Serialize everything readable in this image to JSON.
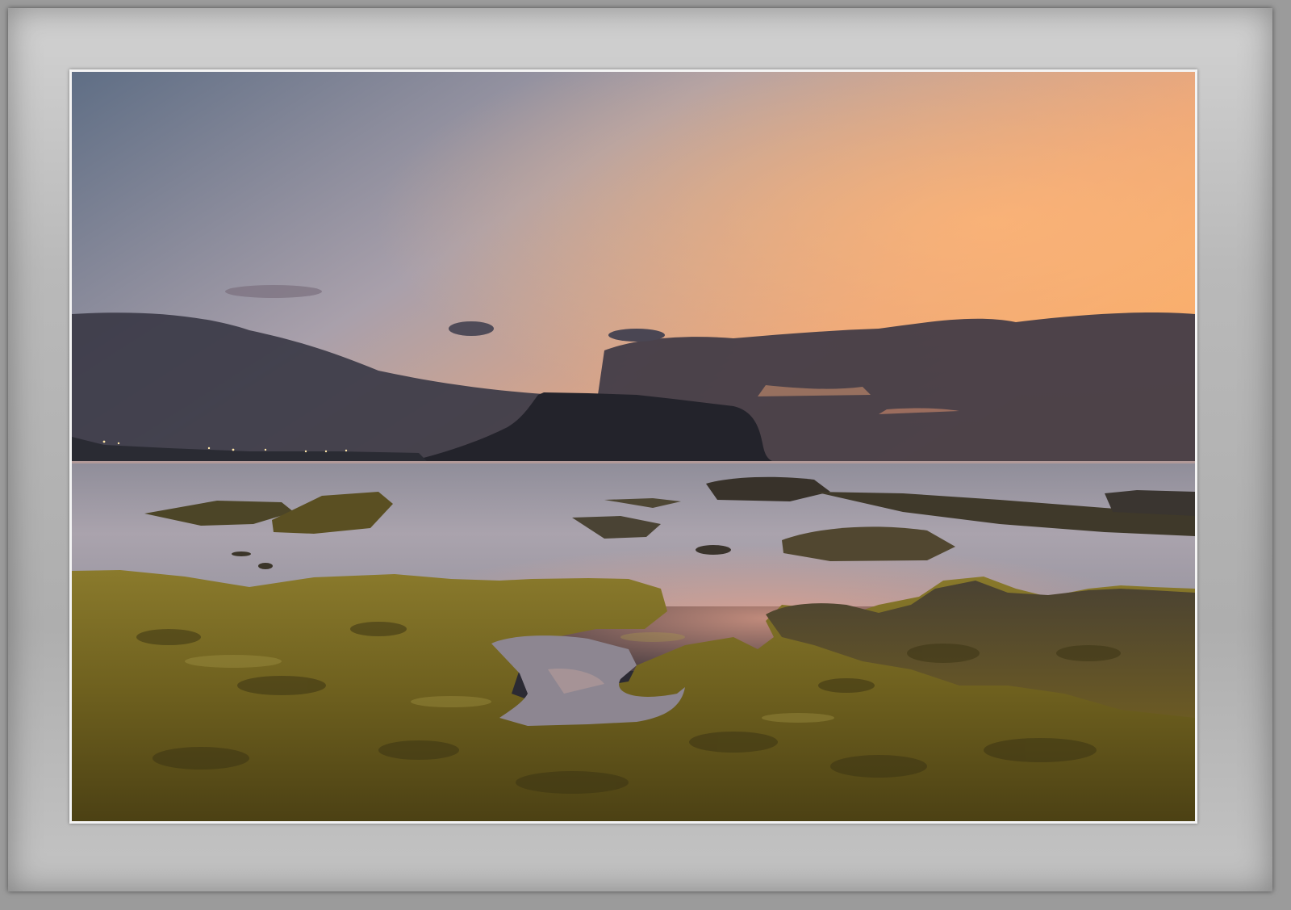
{
  "image": {
    "subject": "seaside-sunset",
    "colors": {
      "sky_top": "#6d7b8f",
      "sky_mid": "#b3a3a8",
      "sky_glow": "#f2a36e",
      "cloud_dark": "#3a3743",
      "sea": "#9c9aa6",
      "sea_reflection": "#d8a596",
      "headland": "#23232b",
      "moss": "#7a6a22",
      "rock_dark": "#2a2620",
      "mat": "#b8b8b8"
    }
  }
}
